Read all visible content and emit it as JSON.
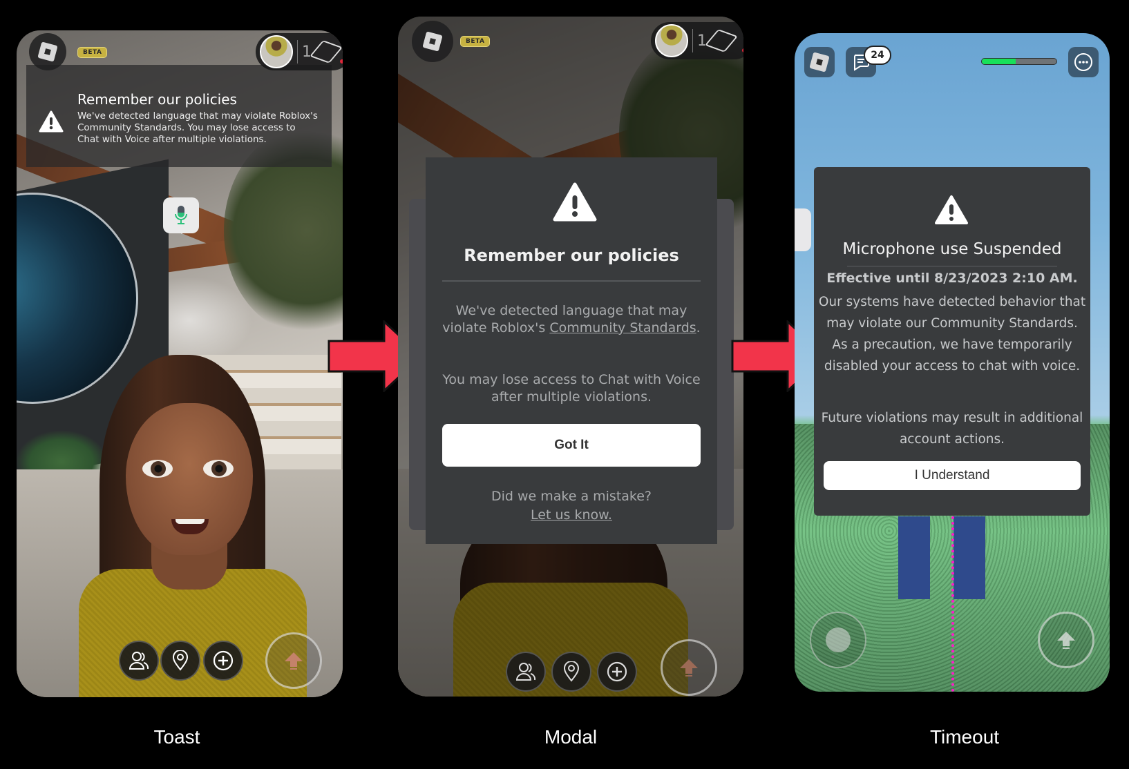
{
  "panels": [
    {
      "id": "toast",
      "caption": "Toast",
      "hud": {
        "beta_label": "BETA",
        "friends_count": "1"
      },
      "toast": {
        "title": "Remember our policies",
        "body": "We've detected language that may violate Roblox's Community Standards. You may lose access to Chat with Voice after multiple violations."
      },
      "bottom_buttons": [
        "friends-icon",
        "location-pin-icon",
        "plus-icon",
        "jump-arrow-icon"
      ]
    },
    {
      "id": "modal",
      "caption": "Modal",
      "hud": {
        "beta_label": "BETA",
        "friends_count": "1"
      },
      "modal": {
        "title": "Remember our policies",
        "paragraph1_prefix": "We've detected language that may violate Roblox's ",
        "paragraph1_link": "Community Standards",
        "paragraph1_suffix": ".",
        "paragraph2": "You may lose access to Chat with Voice after multiple violations.",
        "button_label": "Got It",
        "mistake_text": "Did we make a mistake?",
        "mistake_link": "Let us know."
      }
    },
    {
      "id": "timeout",
      "caption": "Timeout",
      "hud": {
        "chat_badge_count": "24",
        "health_fraction": 0.45
      },
      "modal": {
        "title": "Microphone use Suspended",
        "effective": "Effective until 8/23/2023 2:10 AM.",
        "paragraph1": "Our systems have detected behavior that may violate our Community Standards. As a precaution, we have temporarily disabled your access to chat with voice.",
        "paragraph2": "Future violations may result in additional account actions.",
        "button_label": "I Understand"
      }
    }
  ],
  "colors": {
    "arrow": "#f2344a",
    "modal_bg": "#393b3d",
    "health_fill": "#18e05a",
    "beta_badge": "#c7b241",
    "guide_line": "#ff19c8"
  }
}
